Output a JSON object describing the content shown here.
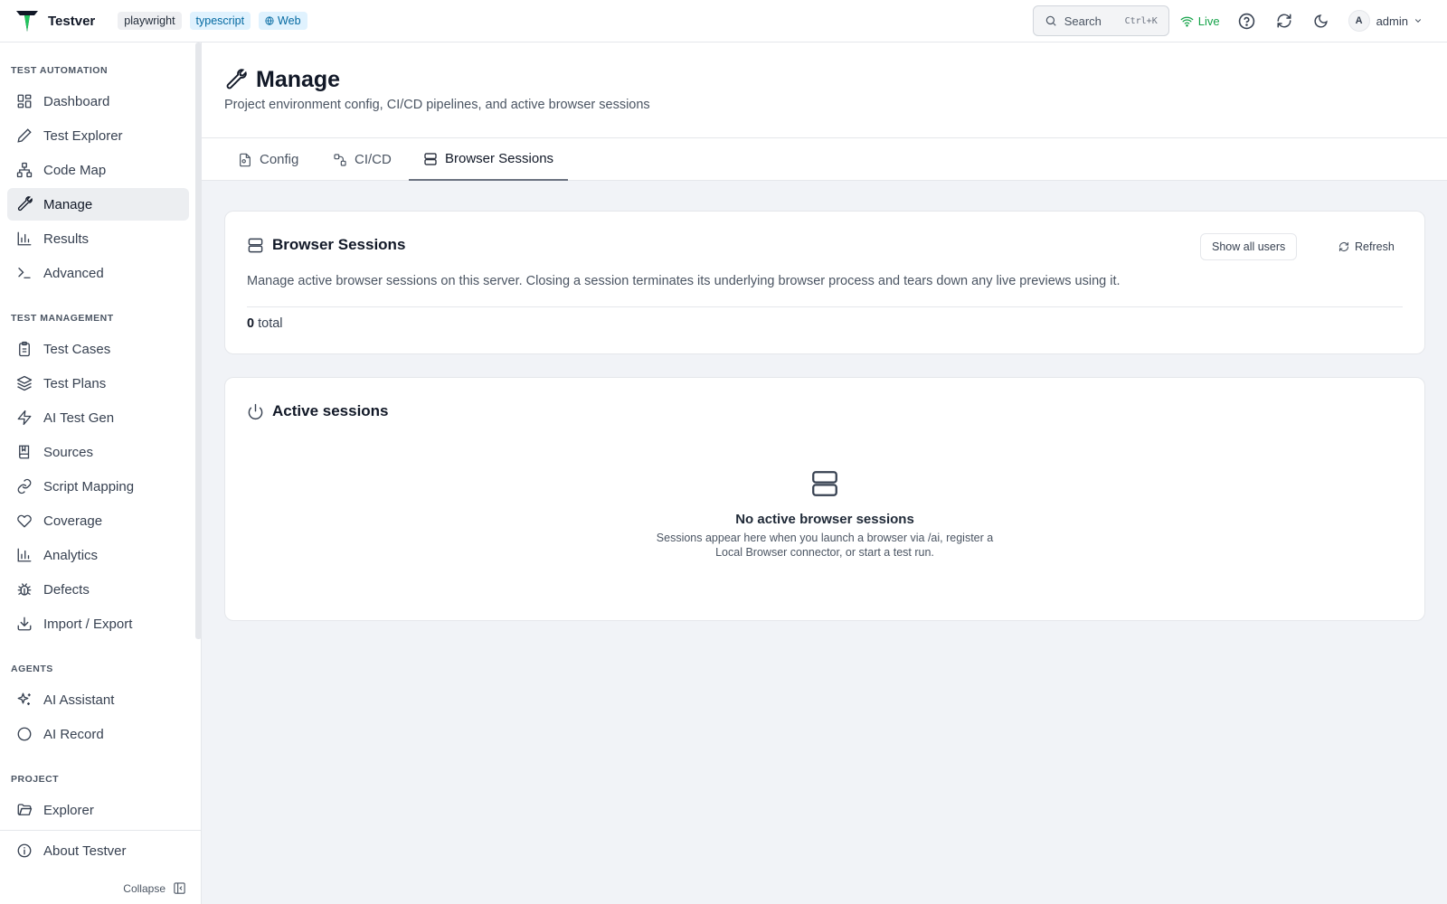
{
  "app": {
    "name": "Testver",
    "tags": [
      "playwright",
      "typescript",
      "Web"
    ]
  },
  "topbar": {
    "search_label": "Search",
    "search_shortcut": "Ctrl+K",
    "live_label": "Live",
    "user_initial": "A",
    "user_name": "admin"
  },
  "sidebar": {
    "sections": {
      "automation": "TEST AUTOMATION",
      "management": "TEST MANAGEMENT",
      "agents": "AGENTS",
      "project": "PROJECT"
    },
    "items": [
      {
        "label": "Dashboard",
        "icon": "dashboard-icon"
      },
      {
        "label": "Test Explorer",
        "icon": "pen-icon"
      },
      {
        "label": "Code Map",
        "icon": "network-icon"
      },
      {
        "label": "Manage",
        "icon": "wrench-icon",
        "active": true
      },
      {
        "label": "Results",
        "icon": "bar-chart-icon"
      },
      {
        "label": "Advanced",
        "icon": "terminal-icon"
      },
      {
        "label": "Test Cases",
        "icon": "clipboard-icon"
      },
      {
        "label": "Test Plans",
        "icon": "layers-icon"
      },
      {
        "label": "AI Test Gen",
        "icon": "zap-icon"
      },
      {
        "label": "Sources",
        "icon": "book-icon"
      },
      {
        "label": "Script Mapping",
        "icon": "link-icon"
      },
      {
        "label": "Coverage",
        "icon": "heart-icon"
      },
      {
        "label": "Analytics",
        "icon": "bar-chart-icon"
      },
      {
        "label": "Defects",
        "icon": "bug-icon"
      },
      {
        "label": "Import / Export",
        "icon": "download-icon"
      },
      {
        "label": "AI Assistant",
        "icon": "sparkles-icon"
      },
      {
        "label": "AI Record",
        "icon": "circle-icon"
      },
      {
        "label": "Explorer",
        "icon": "folder-icon"
      },
      {
        "label": "About Testver",
        "icon": "info-icon"
      }
    ],
    "collapse_label": "Collapse"
  },
  "page": {
    "title": "Manage",
    "subtitle": "Project environment config, CI/CD pipelines, and active browser sessions",
    "tabs": [
      {
        "label": "Config",
        "icon": "file-icon"
      },
      {
        "label": "CI/CD",
        "icon": "pipeline-icon"
      },
      {
        "label": "Browser Sessions",
        "icon": "server-icon",
        "active": true
      }
    ]
  },
  "sessions_card": {
    "title": "Browser Sessions",
    "show_all_label": "Show all users",
    "refresh_label": "Refresh",
    "description": "Manage active browser sessions on this server. Closing a session terminates its underlying browser process and tears down any live previews using it.",
    "total_count": "0",
    "total_label": "total"
  },
  "active_card": {
    "title": "Active sessions",
    "empty_title": "No active browser sessions",
    "empty_text": "Sessions appear here when you launch a browser via /ai, register a Local Browser connector, or start a test run."
  }
}
